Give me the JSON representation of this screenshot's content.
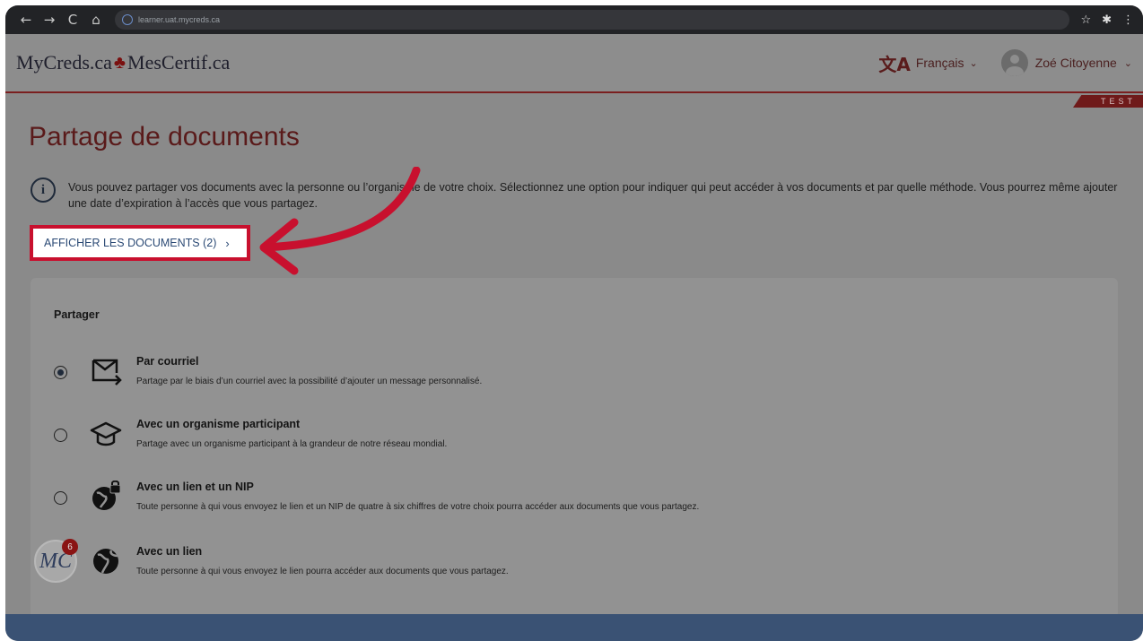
{
  "browser": {
    "url": "learner.uat.mycreds.ca",
    "back_icon": "←",
    "forward_icon": "→",
    "reload_icon": "C",
    "home_icon": "⌂",
    "star_icon": "☆",
    "extensions_icon": "✱",
    "menu_icon": "⋮"
  },
  "header": {
    "brand_left": "MyCreds.ca",
    "brand_right": "MesCertif.ca",
    "language": "Français",
    "user_name": "Zoé Citoyenne",
    "env_tag": "TEST"
  },
  "page": {
    "title": "Partage de documents",
    "info_text": "Vous pouvez partager vos documents avec la personne ou l’organisme de votre choix. Sélectionnez une option pour indiquer qui peut accéder à vos documents et par quelle méthode. Vous pourrez même ajouter une date d’expiration à l’accès que vous partagez.",
    "show_docs_label": "AFFICHER LES DOCUMENTS (2)"
  },
  "share": {
    "title": "Partager",
    "options": [
      {
        "label": "Par courriel",
        "desc": "Partage par le biais d’un courriel avec la possibilité d’ajouter un message personnalisé.",
        "icon": "email-send-icon",
        "selected": true
      },
      {
        "label": "Avec un organisme participant",
        "desc": "Partage avec un organisme participant à la grandeur de notre réseau mondial.",
        "icon": "graduation-cap-icon",
        "selected": false
      },
      {
        "label": "Avec un lien et un NIP",
        "desc": "Toute personne à qui vous envoyez le lien et un NIP de quatre à six chiffres de votre choix pourra accéder aux documents que vous partagez.",
        "icon": "globe-lock-icon",
        "selected": false
      },
      {
        "label": "Avec un lien",
        "desc": "Toute personne à qui vous envoyez le lien pourra accéder aux documents que vous partagez.",
        "icon": "globe-icon",
        "selected": false
      }
    ]
  },
  "badge": {
    "initials": "MC",
    "count": "6"
  },
  "colors": {
    "annotation_red": "#c8102e",
    "brand_maroon": "#7a1f1f",
    "link_blue": "#2b4a75"
  }
}
